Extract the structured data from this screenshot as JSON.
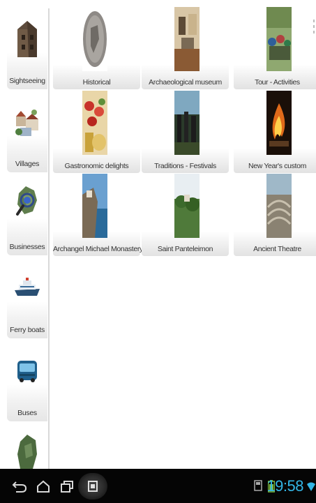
{
  "sidebar": {
    "items": [
      {
        "label": "Sightseeing",
        "icon": "castle-icon"
      },
      {
        "label": "Villages",
        "icon": "village-icon"
      },
      {
        "label": "Businesses",
        "icon": "map-search-icon"
      },
      {
        "label": "Ferry boats",
        "icon": "ferry-icon"
      },
      {
        "label": "Buses",
        "icon": "bus-icon"
      },
      {
        "label": "",
        "icon": "map-icon"
      }
    ]
  },
  "grid": {
    "tiles": [
      {
        "label": "Historical"
      },
      {
        "label": "Archaeological museum"
      },
      {
        "label": "Tour - Activities"
      },
      {
        "label": "Gastronomic delights"
      },
      {
        "label": "Traditions - Festivals"
      },
      {
        "label": "New Year's custom"
      },
      {
        "label": "Archangel Michael Monastery"
      },
      {
        "label": "Saint Panteleimon"
      },
      {
        "label": "Ancient Theatre"
      }
    ]
  },
  "statusbar": {
    "time": "19:58",
    "accent": "#33b5e5"
  }
}
